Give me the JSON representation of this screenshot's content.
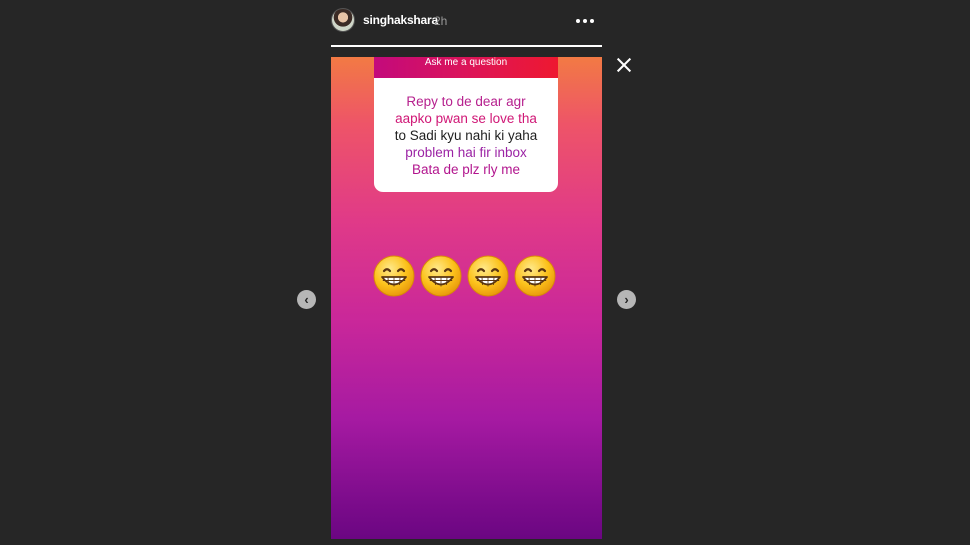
{
  "header": {
    "username": "singhakshara",
    "time": "2h"
  },
  "story": {
    "question_label": "Ask me a question",
    "answer_lines": [
      "Repy to de dear agr",
      "aapko pwan se love tha",
      "to Sadi kyu nahi ki yaha",
      "problem hai fir inbox",
      "Bata de plz rly me"
    ],
    "emojis": [
      "grinning-face-icon",
      "grinning-face-icon",
      "grinning-face-icon",
      "grinning-face-icon"
    ],
    "progress": 1.0
  },
  "controls": {
    "prev_glyph": "‹",
    "next_glyph": "›",
    "more_icon": "more-options-icon",
    "close_icon": "close-icon"
  },
  "colors": {
    "background": "#262626",
    "story_top": "#f27a44",
    "story_bottom": "#6b0682",
    "question_header": "#de1556"
  }
}
